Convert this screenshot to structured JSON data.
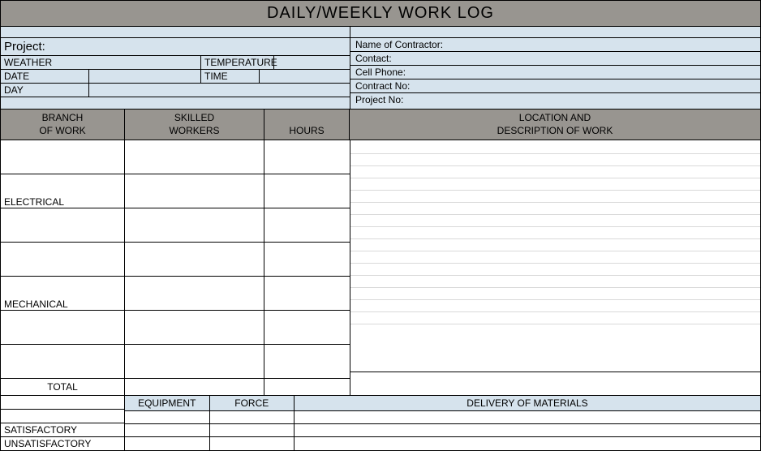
{
  "title": "DAILY/WEEKLY WORK LOG",
  "left": {
    "project_label": "Project:",
    "weather_label": "WEATHER",
    "weather": "",
    "temperature_label": "TEMPERATURE",
    "temperature": "",
    "date_label": "DATE",
    "date": "",
    "time_label": "TIME",
    "time": "",
    "day_label": "DAY",
    "day": ""
  },
  "right": {
    "contractor_label": "Name of Contractor:",
    "contractor": "",
    "contact_label": "Contact:",
    "contact": "",
    "cellphone_label": "Cell Phone:",
    "cellphone": "",
    "contractno_label": "Contract No:",
    "contractno": "",
    "projectno_label": "Project No:",
    "projectno": ""
  },
  "midheaders": {
    "branch_l1": "BRANCH",
    "branch_l2": "OF WORK",
    "skilled_l1": "SKILLED",
    "skilled_l2": "WORKERS",
    "hours": "HOURS",
    "loc_l1": "LOCATION AND",
    "loc_l2": "DESCRIPTION OF WORK"
  },
  "rows": [
    {
      "branch": "",
      "skilled": "",
      "hours": ""
    },
    {
      "branch": "ELECTRICAL",
      "skilled": "",
      "hours": ""
    },
    {
      "branch": "",
      "skilled": "",
      "hours": ""
    },
    {
      "branch": "",
      "skilled": "",
      "hours": ""
    },
    {
      "branch": "MECHANICAL",
      "skilled": "",
      "hours": ""
    },
    {
      "branch": "",
      "skilled": "",
      "hours": ""
    },
    {
      "branch": "",
      "skilled": "",
      "hours": ""
    }
  ],
  "total_label": "TOTAL",
  "bottom": {
    "equipment_label": "EQUIPMENT",
    "force_label": "FORCE",
    "delivery_label": "DELIVERY OF MATERIALS",
    "satisfactory_label": "SATISFACTORY",
    "unsatisfactory_label": "UNSATISFACTORY"
  }
}
